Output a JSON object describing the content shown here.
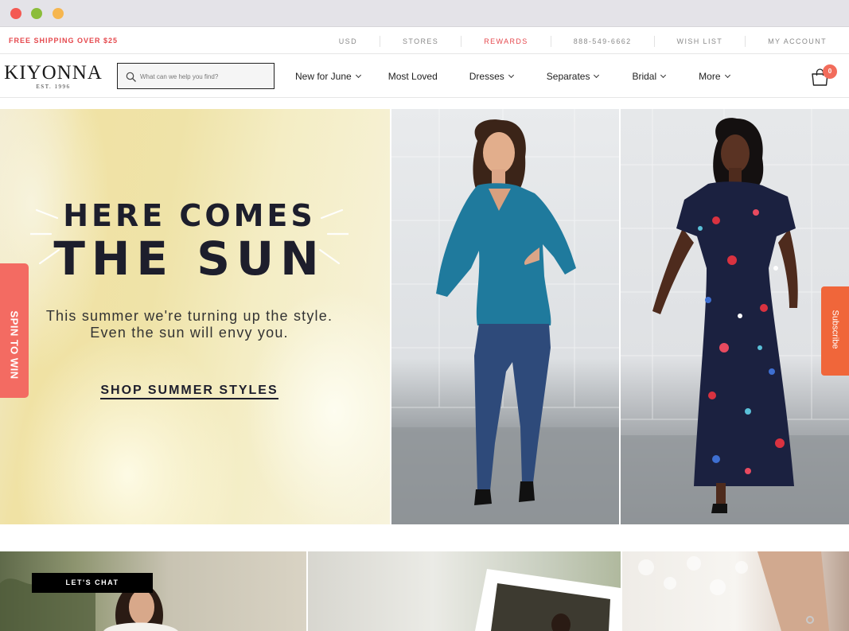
{
  "window": {
    "controls": [
      "close",
      "minimize",
      "maximize"
    ]
  },
  "utility_bar": {
    "promo": "FREE SHIPPING OVER $25",
    "links": [
      "USD",
      "STORES",
      "REWARDS",
      "888-549-6662",
      "WISH LIST",
      "MY ACCOUNT"
    ],
    "accent_color": "#e5484d"
  },
  "header": {
    "logo": "KIYONNA",
    "logo_sub": "EST. 1996",
    "search_placeholder": "What can we help you find?",
    "menu": [
      {
        "label": "New for June",
        "dropdown": true
      },
      {
        "label": "Most Loved",
        "dropdown": false
      },
      {
        "label": "Dresses",
        "dropdown": true
      },
      {
        "label": "Separates",
        "dropdown": true
      },
      {
        "label": "Bridal",
        "dropdown": true
      },
      {
        "label": "More",
        "dropdown": true
      }
    ],
    "cart_count": "0",
    "cart_icon": "shopping-bag-icon"
  },
  "hero": {
    "headline_line1": "HERE COMES",
    "headline_line2": "THE SUN",
    "subline_1": "This summer we're turning up the style.",
    "subline_2": "Even the sun will envy you.",
    "cta": "SHOP SUMMER STYLES",
    "photos": [
      "model-teal-peplum-top",
      "model-navy-floral-maxi-dress"
    ]
  },
  "side_tabs": {
    "spin": "SPIN TO WIN",
    "subscribe": "Subscribe",
    "spin_color": "#f36b62",
    "subscribe_color": "#f0663a"
  },
  "chat": {
    "label": "LET'S CHAT"
  }
}
